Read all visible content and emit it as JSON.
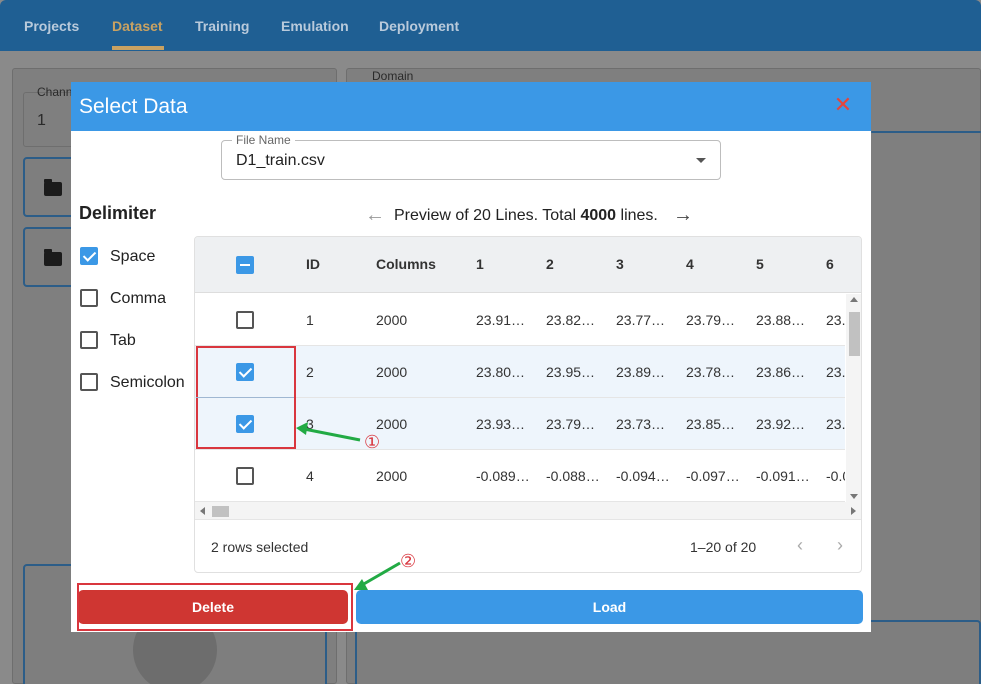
{
  "app": {
    "tabs": [
      "Projects",
      "Dataset",
      "Training",
      "Emulation",
      "Deployment"
    ],
    "active_tab": "Dataset"
  },
  "background": {
    "channel_label": "Chann",
    "channel_value": "1",
    "domain_label": "Domain"
  },
  "dialog": {
    "title": "Select Data",
    "close_icon": "close-icon",
    "file_field": {
      "label": "File Name",
      "value": "D1_train.csv"
    },
    "delimiter": {
      "title": "Delimiter",
      "options": [
        {
          "label": "Space",
          "checked": true
        },
        {
          "label": "Comma",
          "checked": false
        },
        {
          "label": "Tab",
          "checked": false
        },
        {
          "label": "Semicolon",
          "checked": false
        }
      ]
    },
    "preview": {
      "prefix": "Preview of 20 Lines. Total ",
      "total": "4000",
      "suffix": " lines."
    },
    "grid": {
      "columns": [
        "ID",
        "Columns",
        "1",
        "2",
        "3",
        "4",
        "5",
        "6"
      ],
      "rows": [
        {
          "selected": false,
          "cells": [
            "1",
            "2000",
            "23.91…",
            "23.82…",
            "23.77…",
            "23.79…",
            "23.88…",
            "23."
          ]
        },
        {
          "selected": true,
          "cells": [
            "2",
            "2000",
            "23.80…",
            "23.95…",
            "23.89…",
            "23.78…",
            "23.86…",
            "23."
          ]
        },
        {
          "selected": true,
          "cells": [
            "3",
            "2000",
            "23.93…",
            "23.79…",
            "23.73…",
            "23.85…",
            "23.92…",
            "23."
          ]
        },
        {
          "selected": false,
          "cells": [
            "4",
            "2000",
            "-0.089…",
            "-0.088…",
            "-0.094…",
            "-0.097…",
            "-0.091…",
            "-0.0"
          ]
        }
      ],
      "footer": {
        "selected_text": "2 rows selected",
        "range_text": "1–20 of 20"
      }
    },
    "buttons": {
      "delete": "Delete",
      "load": "Load"
    }
  },
  "annotations": {
    "marker_1": "①",
    "marker_2": "②"
  },
  "colors": {
    "accent": "#3b98e6",
    "danger": "#cf3632",
    "appbar": "#1f5f93",
    "annotation_arrow": "#22aa44"
  }
}
